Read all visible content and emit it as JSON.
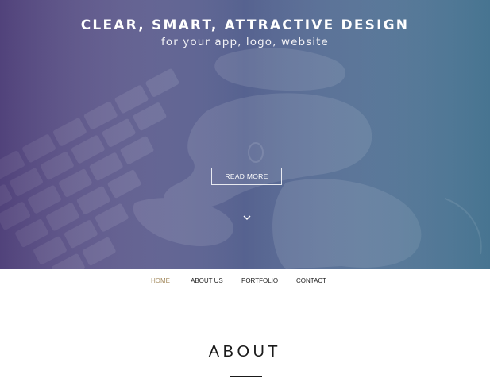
{
  "hero": {
    "title": "CLEAR, SMART, ATTRACTIVE DESIGN",
    "subtitle": "for your app, logo, website",
    "read_more_label": "READ MORE",
    "scroll_icon": "chevron-down-icon"
  },
  "nav": {
    "items": [
      {
        "label": "HOME",
        "active": true
      },
      {
        "label": "ABOUT US",
        "active": false
      },
      {
        "label": "PORTFOLIO",
        "active": false
      },
      {
        "label": "CONTACT",
        "active": false
      }
    ],
    "active_color": "#a48a5e"
  },
  "about": {
    "title": "ABOUT"
  },
  "colors": {
    "hero_gradient_start": "#5b4b86",
    "hero_gradient_end": "#4f7c99",
    "text_dark": "#1a1a1a"
  }
}
